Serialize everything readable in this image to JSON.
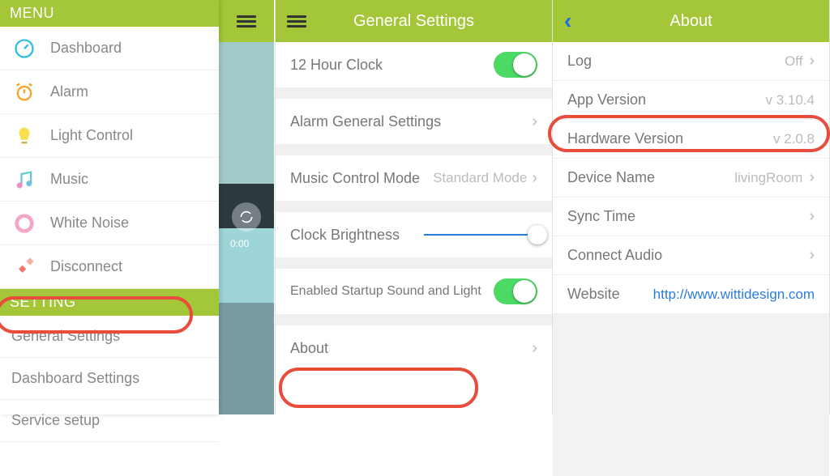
{
  "screen1": {
    "menu_header": "MENU",
    "setting_header": "SETTING",
    "menu_items": [
      {
        "label": "Dashboard"
      },
      {
        "label": "Alarm"
      },
      {
        "label": "Light Control"
      },
      {
        "label": "Music"
      },
      {
        "label": "White Noise"
      },
      {
        "label": "Disconnect"
      }
    ],
    "setting_items": [
      {
        "label": "General Settings"
      },
      {
        "label": "Dashboard Settings"
      },
      {
        "label": "Service setup"
      }
    ],
    "behind_time": "0:00"
  },
  "screen2": {
    "title": "General Settings",
    "rows": {
      "clock12": "12 Hour Clock",
      "alarm_general": "Alarm General Settings",
      "music_mode": "Music Control Mode",
      "music_mode_val": "Standard Mode",
      "brightness": "Clock Brightness",
      "startup": "Enabled Startup Sound and Light",
      "about": "About"
    }
  },
  "screen3": {
    "title": "About",
    "rows": {
      "log": "Log",
      "log_val": "Off",
      "app_version": "App Version",
      "app_version_val": "v 3.10.4",
      "hw_version": "Hardware Version",
      "hw_version_val": "v 2.0.8",
      "device_name": "Device Name",
      "device_name_val": "livingRoom",
      "sync_time": "Sync Time",
      "connect_audio": "Connect Audio",
      "website": "Website",
      "website_val": "http://www.wittidesign.com"
    }
  }
}
